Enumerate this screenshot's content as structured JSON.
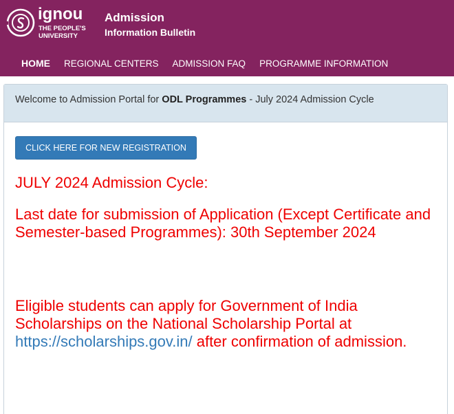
{
  "header": {
    "logo": {
      "wordmark": "ignou",
      "line1": "THE PEOPLE'S",
      "line2": "UNIVERSITY",
      "icon": "ignou-emblem-icon"
    },
    "title": "Admission",
    "subtitle": "Information Bulletin",
    "background": "#84235f"
  },
  "nav": {
    "items": [
      {
        "label": "HOME"
      },
      {
        "label": "REGIONAL CENTERS"
      },
      {
        "label": "ADMISSION FAQ"
      },
      {
        "label": "PROGRAMME INFORMATION"
      }
    ]
  },
  "panel": {
    "welcome_prefix": "Welcome to Admission Portal for ",
    "welcome_bold": "ODL Programmes",
    "welcome_suffix": " - July 2024 Admission Cycle",
    "register_button": "CLICK HERE FOR NEW REGISTRATION",
    "cycle_heading": "JULY 2024 Admission Cycle:",
    "last_date": "Last date for submission of Application (Except Certificate and Semester-based Programmes): 30th September 2024",
    "scholarship_prefix": "Eligible students can apply for Government of India Scholarships on the National Scholarship Portal at ",
    "scholarship_link": "https://scholarships.gov.in/",
    "scholarship_suffix": " after confirmation of admission."
  },
  "colors": {
    "alert_red": "#ee0000",
    "link_blue": "#337ab7",
    "panel_head_bg": "#d8e5ee"
  }
}
